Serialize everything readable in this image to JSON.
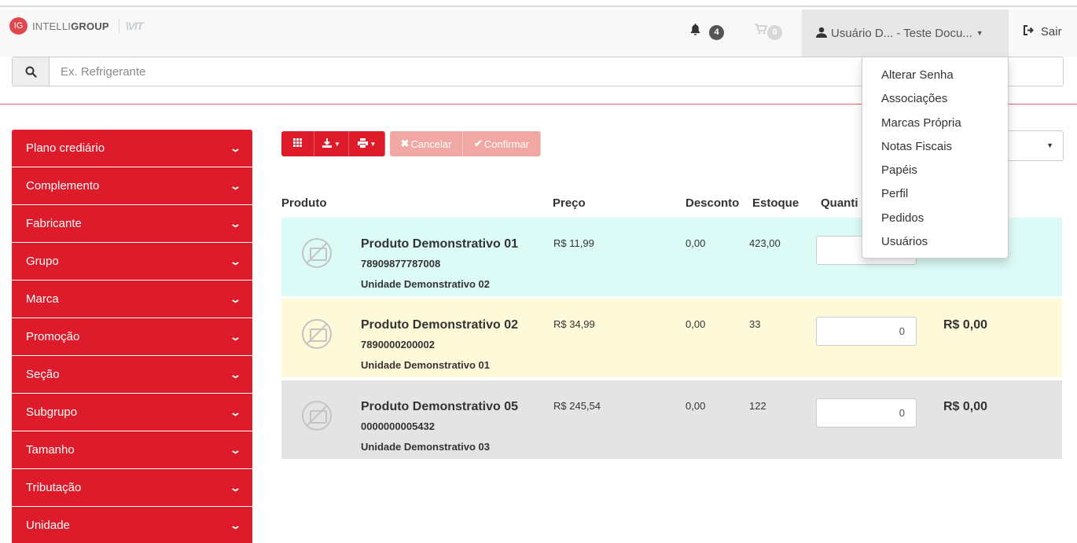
{
  "header": {
    "logo_badge": "IG",
    "logo_text_light": "INTELLI",
    "logo_text_bold": "GROUP",
    "logo_mark": "\\VIT",
    "notifications_count": "4",
    "cart_count": "0",
    "user_label": "Usuário D... - Teste Docu...",
    "logout_label": "Sair"
  },
  "search": {
    "placeholder": "Ex. Refrigerante"
  },
  "user_dropdown": {
    "items": [
      {
        "label": "Alterar Senha"
      },
      {
        "label": "Associações"
      },
      {
        "label": "Marcas Própria"
      },
      {
        "label": "Notas Fiscais"
      },
      {
        "label": "Papéis"
      },
      {
        "label": "Perfil"
      },
      {
        "label": "Pedidos"
      },
      {
        "label": "Usuários"
      }
    ]
  },
  "sidebar": {
    "items": [
      {
        "label": "Plano crediário"
      },
      {
        "label": "Complemento"
      },
      {
        "label": "Fabricante"
      },
      {
        "label": "Grupo"
      },
      {
        "label": "Marca"
      },
      {
        "label": "Promoção"
      },
      {
        "label": "Seção"
      },
      {
        "label": "Subgrupo"
      },
      {
        "label": "Tamanho"
      },
      {
        "label": "Tributação"
      },
      {
        "label": "Unidade"
      }
    ]
  },
  "toolbar": {
    "cancel_label": "Cancelar",
    "confirm_label": "Confirmar"
  },
  "table": {
    "headers": {
      "produto": "Produto",
      "preco": "Preço",
      "desconto": "Desconto",
      "estoque": "Estoque",
      "quantidade": "Quanti"
    },
    "rows": [
      {
        "name": "Produto Demonstrativo 01",
        "code": "78909877787008",
        "unit": "Unidade Demonstrativo 02",
        "price": "R$ 11,99",
        "discount": "0,00",
        "stock": "423,00",
        "qty": "",
        "total": ""
      },
      {
        "name": "Produto Demonstrativo 02",
        "code": "7890000200002",
        "unit": "Unidade Demonstrativo 01",
        "price": "R$ 34,99",
        "discount": "0,00",
        "stock": "33",
        "qty": "0",
        "total": "R$ 0,00"
      },
      {
        "name": "Produto Demonstrativo 05",
        "code": "0000000005432",
        "unit": "Unidade Demonstrativo 03",
        "price": "R$ 245,54",
        "discount": "0,00",
        "stock": "122",
        "qty": "0",
        "total": "R$ 0,00"
      }
    ]
  },
  "colors": {
    "brand_red": "#dd1b2a",
    "disabled_red": "#f1a7a3",
    "row_cyan": "#dcfbf7",
    "row_yellow": "#fef9d9",
    "row_gray": "#e4e4e4"
  }
}
